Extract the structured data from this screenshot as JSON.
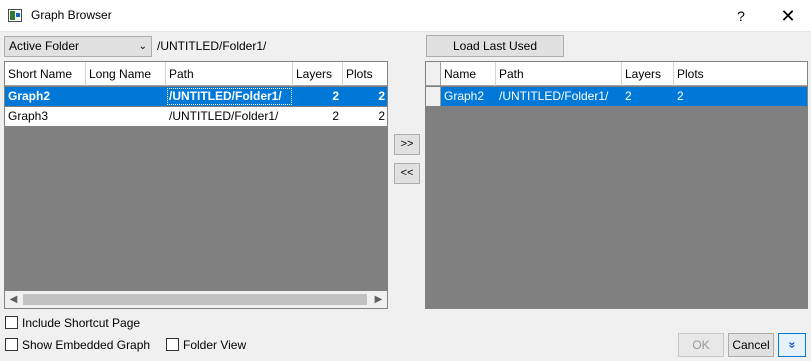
{
  "window": {
    "title": "Graph Browser",
    "help_label": "?",
    "close_label": "✕"
  },
  "source": {
    "folder_dropdown": "Active Folder",
    "folder_path": "/UNTITLED/Folder1/",
    "columns": [
      "Short Name",
      "Long Name",
      "Path",
      "Layers",
      "Plots"
    ],
    "rows": [
      {
        "short_name": "Graph2",
        "long_name": "",
        "path": "/UNTITLED/Folder1/",
        "layers": "2",
        "plots": "2",
        "selected": true
      },
      {
        "short_name": "Graph3",
        "long_name": "",
        "path": "/UNTITLED/Folder1/",
        "layers": "2",
        "plots": "2",
        "selected": false
      }
    ]
  },
  "transfer": {
    "add_label": ">>",
    "remove_label": "<<"
  },
  "target": {
    "load_last_used_label": "Load Last Used",
    "columns": [
      "Name",
      "Path",
      "Layers",
      "Plots"
    ],
    "rows": [
      {
        "name": "Graph2",
        "path": "/UNTITLED/Folder1/",
        "layers": "2",
        "plots": "2",
        "selected": true
      }
    ]
  },
  "options": {
    "include_shortcut_page": {
      "label": "Include Shortcut Page",
      "checked": false
    },
    "show_embedded_graph": {
      "label": "Show Embedded Graph",
      "checked": false
    },
    "folder_view": {
      "label": "Folder View",
      "checked": false
    }
  },
  "footer": {
    "ok_label": "OK",
    "cancel_label": "Cancel",
    "more_label": "»"
  },
  "colors": {
    "selection": "#0078d7",
    "grid_background": "#808080",
    "dialog_background": "#f0f0f0"
  }
}
